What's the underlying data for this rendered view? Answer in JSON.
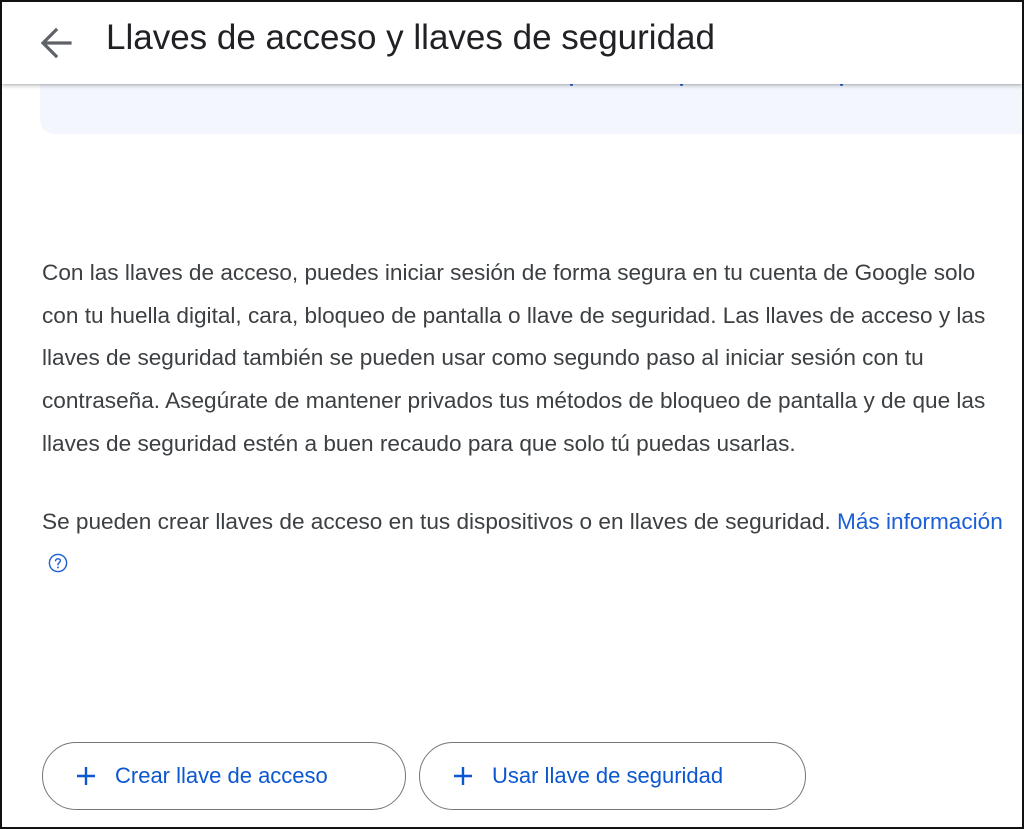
{
  "header": {
    "title": "Llaves de acceso y llaves de seguridad",
    "back_icon": "arrow-back-icon"
  },
  "content": {
    "paragraph1": "Con las llaves de acceso, puedes iniciar sesión de forma segura en tu cuenta de Google solo con tu huella digital, cara, bloqueo de pantalla o llave de seguridad. Las llaves de acceso y las llaves de seguridad también se pueden usar como segundo paso al iniciar sesión con tu contraseña. Asegúrate de mantener privados tus métodos de bloqueo de pantalla y de que las llaves de seguridad estén a buen recaudo para que solo tú puedas usarlas.",
    "paragraph2_text": "Se pueden crear llaves de acceso en tus dispositivos o en llaves de seguridad.",
    "more_info_link": "Más información",
    "help_icon": "help-circle-icon"
  },
  "actions": {
    "create_passkey": "Crear llave de acceso",
    "use_security_key": "Usar llave de seguridad",
    "plus_icon": "plus-icon"
  },
  "colors": {
    "accent": "#0b57d0",
    "link": "#1a5fd6",
    "body_text": "#3c4043",
    "title_text": "#202124",
    "card_bg": "#f3f6fc",
    "button_border": "#747775"
  }
}
